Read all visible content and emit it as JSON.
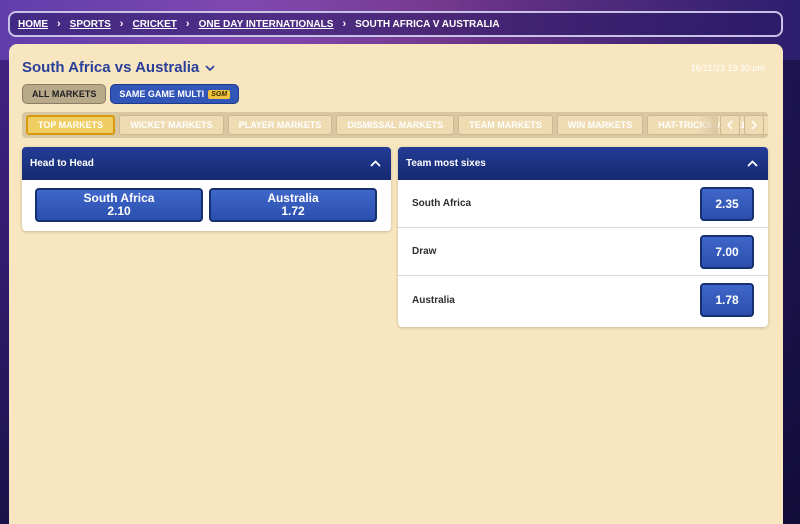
{
  "breadcrumb": {
    "home": "HOME",
    "sports": "SPORTS",
    "cricket": "CRICKET",
    "odi": "ONE DAY INTERNATIONALS",
    "current": "SOUTH AFRICA V AUSTRALIA"
  },
  "event": {
    "title": "South Africa vs Australia",
    "datetime": "16/11/23 19:30 pm"
  },
  "filters": {
    "all_markets": "ALL MARKETS",
    "same_game_multi": "SAME GAME MULTI",
    "sgm_badge": "SGM"
  },
  "tabs": [
    {
      "label": "TOP MARKETS"
    },
    {
      "label": "WICKET MARKETS"
    },
    {
      "label": "PLAYER MARKETS"
    },
    {
      "label": "DISMISSAL MARKETS"
    },
    {
      "label": "TEAM MARKETS"
    },
    {
      "label": "WIN MARKETS"
    },
    {
      "label": "HAT-TRICKS MARKETS"
    },
    {
      "label": "P"
    }
  ],
  "head_to_head": {
    "title": "Head to Head",
    "options": [
      {
        "team": "South Africa",
        "odds": "2.10"
      },
      {
        "team": "Australia",
        "odds": "1.72"
      }
    ]
  },
  "team_most_sixes": {
    "title": "Team most sixes",
    "rows": [
      {
        "label": "South Africa",
        "odds": "2.35"
      },
      {
        "label": "Draw",
        "odds": "7.00"
      },
      {
        "label": "Australia",
        "odds": "1.78"
      }
    ]
  },
  "colors": {
    "panel_bg": "#f7e6bf",
    "header_blue": "#1d3380",
    "odds_blue": "#3256b8",
    "active_tab": "#f0cd63",
    "title_blue": "#2a3f9a"
  },
  "icons": {
    "breadcrumb_separator": "chevron-right-icon",
    "title_dropdown": "chevron-down-icon",
    "collapse": "chevron-up-icon",
    "tabs_prev": "chevron-left-icon",
    "tabs_next": "chevron-right-icon"
  }
}
